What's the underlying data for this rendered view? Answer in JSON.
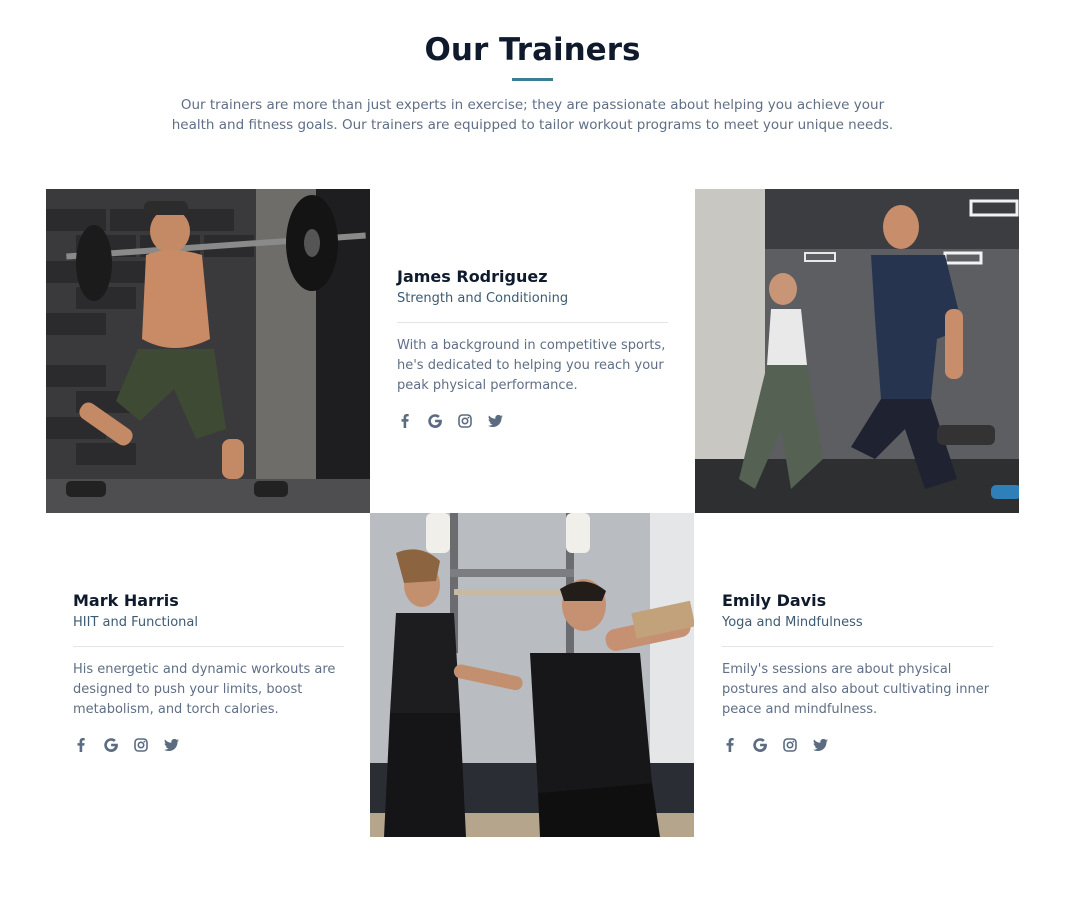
{
  "section": {
    "title": "Our Trainers",
    "intro": "Our trainers are more than just experts in exercise; they are passionate about helping you achieve your health and fitness goals. Our trainers are equipped to tailor workout programs to meet your unique needs."
  },
  "colors": {
    "heading": "#0f1b2d",
    "accent": "#3a7d94",
    "body_text": "#5f6f86",
    "role_text": "#3e5b73",
    "icon": "#5b6c80"
  },
  "trainers": [
    {
      "name": "James Rodriguez",
      "role": "Strength and Conditioning",
      "bio": "With a background in competitive sports, he's dedicated to helping you reach your peak physical performance.",
      "socials": [
        "facebook-icon",
        "google-icon",
        "instagram-icon",
        "twitter-icon"
      ]
    },
    {
      "name": "Mark Harris",
      "role": "HIIT and Functional",
      "bio": "His energetic and dynamic workouts are designed to push your limits, boost metabolism, and torch calories.",
      "socials": [
        "facebook-icon",
        "google-icon",
        "instagram-icon",
        "twitter-icon"
      ]
    },
    {
      "name": "Emily Davis",
      "role": "Yoga and Mindfulness",
      "bio": "Emily's sessions are about physical postures and also about cultivating inner peace and mindfulness.",
      "socials": [
        "facebook-icon",
        "google-icon",
        "instagram-icon",
        "twitter-icon"
      ]
    }
  ]
}
